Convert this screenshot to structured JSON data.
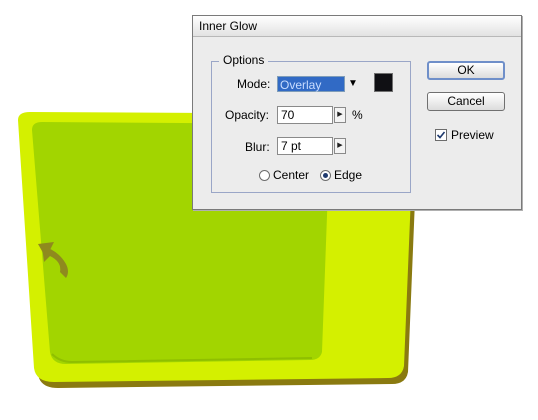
{
  "dialog": {
    "title": "Inner Glow",
    "options_legend": "Options",
    "mode_label": "Mode:",
    "mode_value": "Overlay",
    "opacity_label": "Opacity:",
    "opacity_value": "70",
    "opacity_unit": "%",
    "blur_label": "Blur:",
    "blur_value": "7 pt",
    "radio_center": "Center",
    "radio_edge": "Edge",
    "selected_source": "Edge",
    "ok_label": "OK",
    "cancel_label": "Cancel",
    "preview_label": "Preview",
    "preview_checked": true,
    "glow_color": "#101014"
  },
  "artwork": {
    "outer_fill": "#d4f000",
    "inner_fill": "#a2d500",
    "shadow_color": "#8a7a10",
    "arrow_color": "#8f8a1e"
  }
}
